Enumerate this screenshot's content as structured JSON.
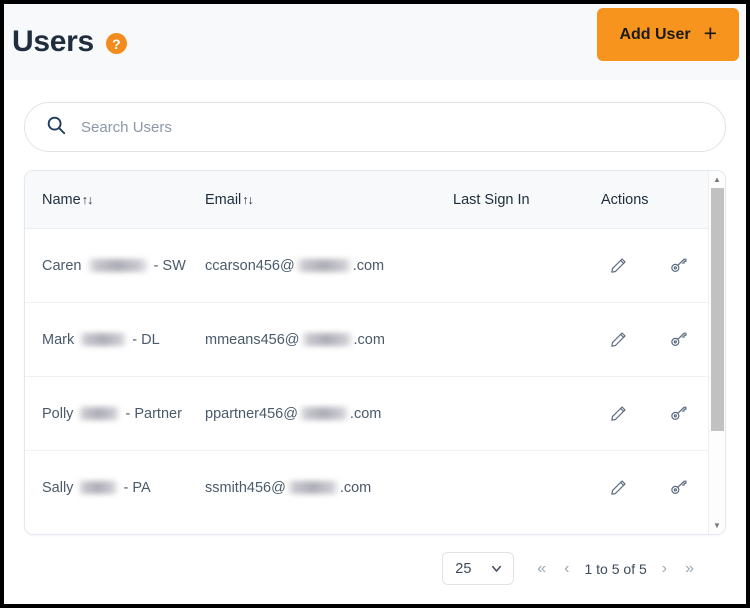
{
  "header": {
    "title": "Users",
    "help_icon": "question-circle-icon",
    "add_user_label": "Add User",
    "add_user_plus": "+",
    "accent_color": "#f7941e",
    "band_color": "#f7f9fb"
  },
  "search": {
    "icon": "search-icon",
    "placeholder": "Search Users",
    "value": ""
  },
  "table": {
    "columns": [
      {
        "label": "Name",
        "sort": "↑↓",
        "sortable": true
      },
      {
        "label": "Email",
        "sort": "↑↓",
        "sortable": true
      },
      {
        "label": "Last Sign In",
        "sort": "",
        "sortable": false
      },
      {
        "label": "Actions",
        "sort": "",
        "sortable": false
      }
    ],
    "rows": [
      {
        "name_prefix": "Caren",
        "name_suffix": "- SW",
        "name_redacted_width": 62,
        "email_prefix": "ccarson456@",
        "email_suffix": ".com",
        "email_redacted_width": 56,
        "last_sign_in": "",
        "actions": [
          "edit-icon",
          "key-icon"
        ]
      },
      {
        "name_prefix": "Mark",
        "name_suffix": "- DL",
        "name_redacted_width": 48,
        "email_prefix": "mmeans456@",
        "email_suffix": ".com",
        "email_redacted_width": 52,
        "last_sign_in": "",
        "actions": [
          "edit-icon",
          "key-icon"
        ]
      },
      {
        "name_prefix": "Polly",
        "name_suffix": "- Partner",
        "name_redacted_width": 42,
        "email_prefix": "ppartner456@",
        "email_suffix": ".com",
        "email_redacted_width": 50,
        "last_sign_in": "",
        "actions": [
          "edit-icon",
          "key-icon"
        ]
      },
      {
        "name_prefix": "Sally",
        "name_suffix": "- PA",
        "name_redacted_width": 40,
        "email_prefix": "ssmith456@",
        "email_suffix": ".com",
        "email_redacted_width": 52,
        "last_sign_in": "",
        "actions": [
          "edit-icon",
          "key-icon"
        ]
      }
    ],
    "scrollbar": {
      "up": "scroll-up-arrow",
      "down": "scroll-down-arrow",
      "thumb_fraction": 0.74
    }
  },
  "pagination": {
    "page_size": "25",
    "chevron": "chevron-down-icon",
    "first_label": "«",
    "prev_label": "‹",
    "info": "1 to 5 of 5",
    "next_label": "›",
    "last_label": "»"
  }
}
